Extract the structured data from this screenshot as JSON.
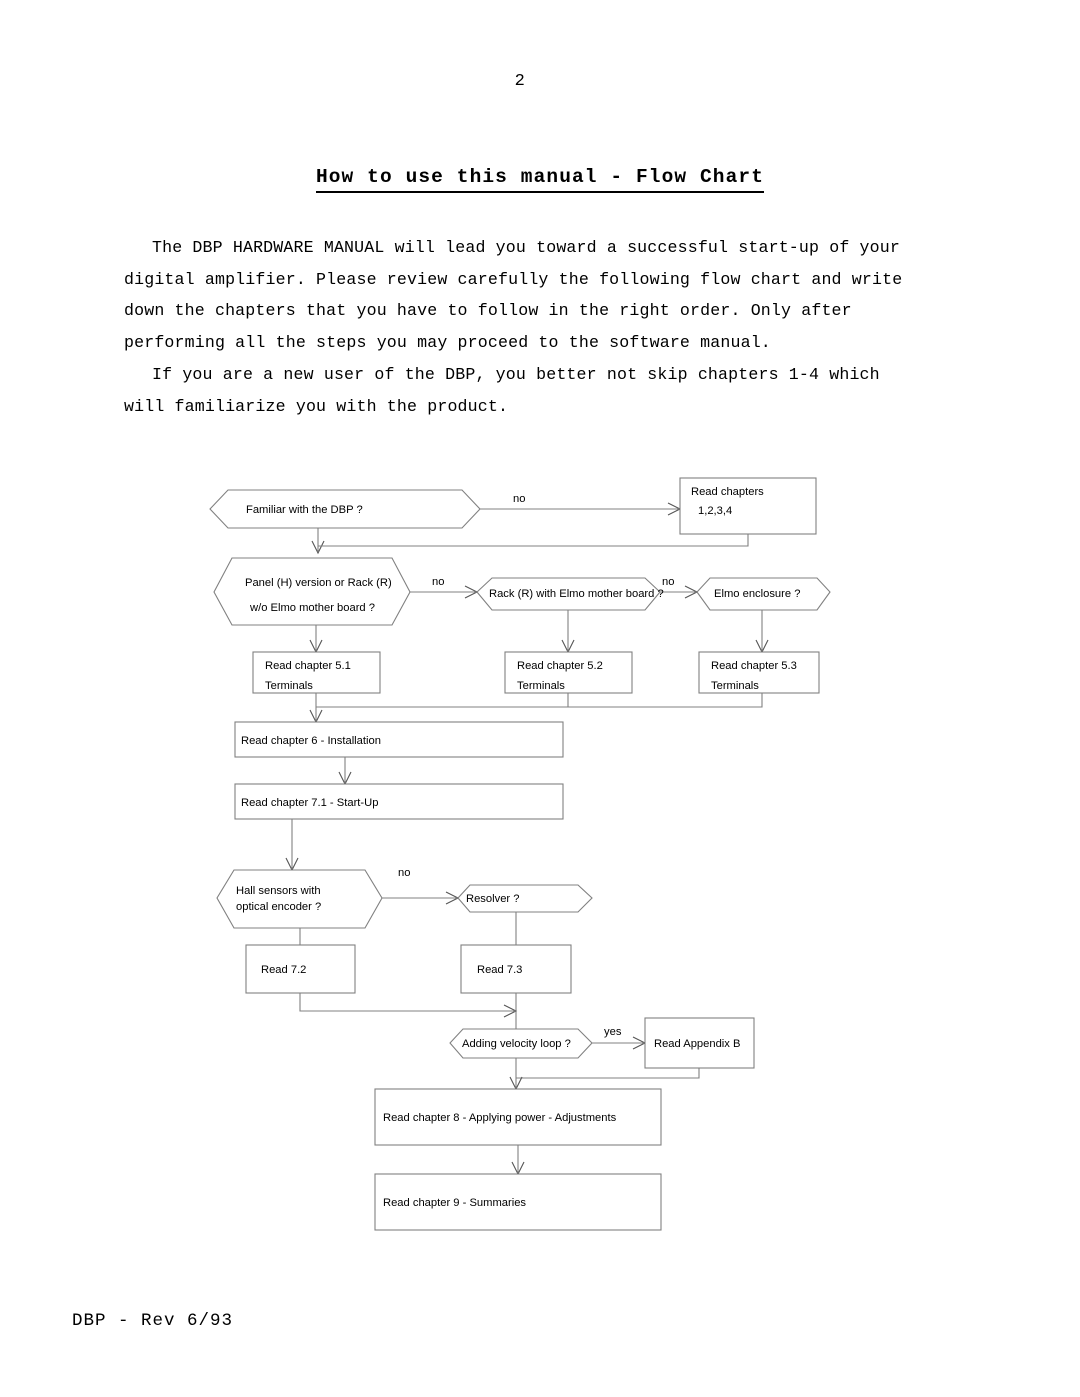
{
  "document": {
    "page_number": "2",
    "title": "How to use this manual - Flow Chart",
    "paragraph_1_line_1": "The DBP HARDWARE MANUAL will lead you toward a successful start-up of your",
    "paragraph_1_line_2": "digital amplifier. Please review carefully the following flow chart and write",
    "paragraph_1_line_3": "down the chapters that you have to follow in the right order. Only after",
    "paragraph_1_line_4": "performing all the steps you may proceed to the software manual.",
    "paragraph_2_line_1": "If you are a new user of the DBP, you better not skip chapters 1-4 which",
    "paragraph_2_line_2": "will familiarize you with the product.",
    "footer": "DBP - Rev 6/93"
  },
  "chart_data": {
    "type": "diagram",
    "title": "How to use this manual - Flow Chart",
    "nodes": [
      {
        "id": "n1",
        "shape": "hexagon",
        "lines": [
          "Familiar with the DBP ?"
        ]
      },
      {
        "id": "n2",
        "shape": "rect",
        "lines": [
          "Read chapters",
          "1,2,3,4"
        ]
      },
      {
        "id": "n3",
        "shape": "hexagon",
        "lines": [
          "Panel (H) version or Rack (R)",
          "w/o Elmo mother board ?"
        ]
      },
      {
        "id": "n4",
        "shape": "hexagon",
        "lines": [
          "Rack (R) with Elmo mother board  ?"
        ]
      },
      {
        "id": "n5",
        "shape": "hexagon",
        "lines": [
          "Elmo enclosure  ?"
        ]
      },
      {
        "id": "n6",
        "shape": "rect",
        "lines": [
          "Read chapter 5.1",
          "Terminals"
        ]
      },
      {
        "id": "n7",
        "shape": "rect",
        "lines": [
          "Read chapter 5.2",
          "Terminals"
        ]
      },
      {
        "id": "n8",
        "shape": "rect",
        "lines": [
          "Read chapter 5.3",
          "Terminals"
        ]
      },
      {
        "id": "n9",
        "shape": "rect",
        "lines": [
          "Read chapter 6 - Installation"
        ]
      },
      {
        "id": "n10",
        "shape": "rect",
        "lines": [
          "Read chapter 7.1 - Start-Up"
        ]
      },
      {
        "id": "n11",
        "shape": "hexagon",
        "lines": [
          "Hall sensors with",
          "optical encoder  ?"
        ]
      },
      {
        "id": "n12",
        "shape": "hexagon",
        "lines": [
          "Resolver  ?"
        ]
      },
      {
        "id": "n13",
        "shape": "rect",
        "lines": [
          "Read 7.2"
        ]
      },
      {
        "id": "n14",
        "shape": "rect",
        "lines": [
          "Read 7.3"
        ]
      },
      {
        "id": "n15",
        "shape": "hexagon",
        "lines": [
          "Adding velocity loop  ?"
        ]
      },
      {
        "id": "n16",
        "shape": "rect",
        "lines": [
          "Read Appendix B"
        ]
      },
      {
        "id": "n17",
        "shape": "rect",
        "lines": [
          "Read chapter 8 - Applying power - Adjustments"
        ]
      },
      {
        "id": "n18",
        "shape": "rect",
        "lines": [
          "Read chapter 9 - Summaries"
        ]
      }
    ],
    "edge_labels": {
      "e1": "no",
      "e2": "no",
      "e3": "no",
      "e4": "no",
      "e5": "yes"
    }
  },
  "colors": {
    "shape_stroke": "#808080",
    "text": "#000000",
    "background": "#ffffff"
  }
}
